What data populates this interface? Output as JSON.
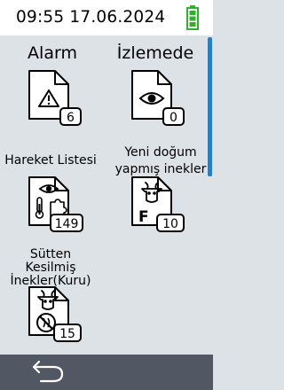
{
  "status": {
    "datetime": "09:55 17.06.2024"
  },
  "tiles": [
    {
      "label": "Alarm",
      "count": "6",
      "icon": "warning-icon"
    },
    {
      "label": "İzlemede",
      "count": "0",
      "icon": "eye-icon"
    },
    {
      "label": "Hareket Listesi",
      "count": "149",
      "icon": "thermometer-eye-puzzle-icon"
    },
    {
      "label_lines": [
        "Yeni doğum",
        "yapmış inekler"
      ],
      "count": "10",
      "icon": "cow-head-f-icon"
    },
    {
      "label_lines": [
        "Sütten",
        "Kesilmiş",
        "İnekler(Kuru)"
      ],
      "count": "15",
      "icon": "cow-no-milk-icon"
    }
  ],
  "colors": {
    "accent": "#2b7fc0",
    "battery": "#2fb12f",
    "bottom_bar": "#525764",
    "background": "#dde2e7"
  },
  "navigation": {
    "back_icon": "return-arrow-icon"
  }
}
